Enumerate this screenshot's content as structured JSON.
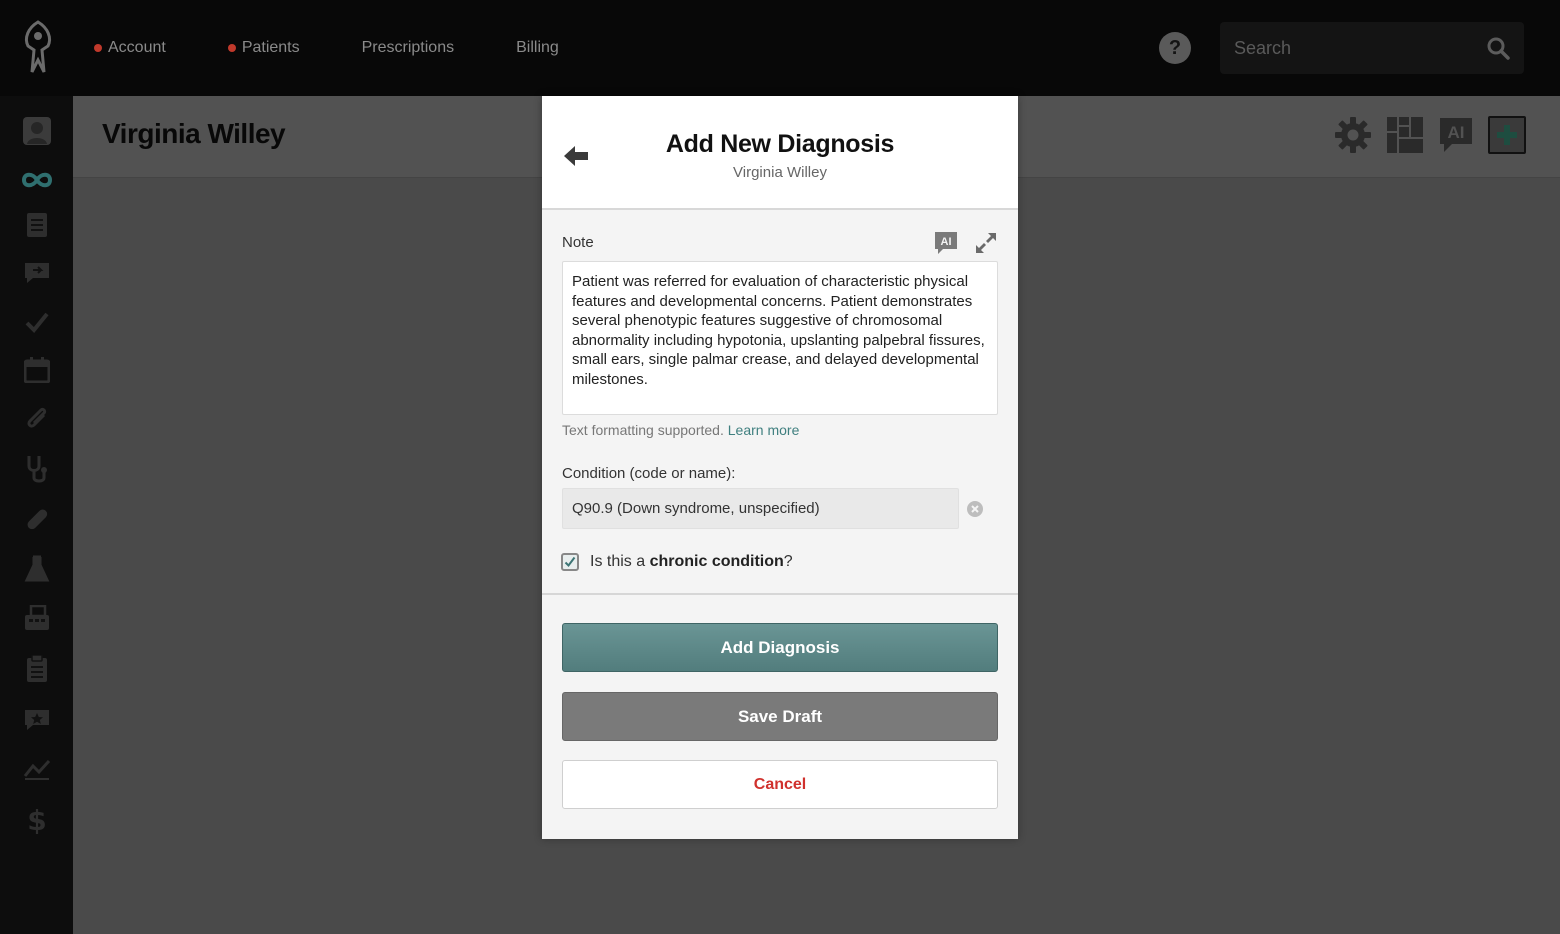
{
  "nav": {
    "items": [
      {
        "label": "Account",
        "alert": true
      },
      {
        "label": "Patients",
        "alert": true
      },
      {
        "label": "Prescriptions",
        "alert": false
      },
      {
        "label": "Billing",
        "alert": false
      }
    ],
    "help_label": "?",
    "search_placeholder": "Search"
  },
  "sidebar": {
    "icons": [
      "profile-icon",
      "timeline-icon",
      "documents-icon",
      "messages-icon",
      "tasks-icon",
      "calendar-icon",
      "attachments-icon",
      "stethoscope-icon",
      "medications-icon",
      "labs-icon",
      "fax-icon",
      "clipboard-icon",
      "reviews-icon",
      "trends-icon",
      "billing-icon"
    ],
    "active": "timeline-icon"
  },
  "header": {
    "patient_name": "Virginia Willey",
    "actions": [
      "settings-icon",
      "dashboard-icon",
      "ai-assistant-icon",
      "add-icon"
    ]
  },
  "modal": {
    "title": "Add New Diagnosis",
    "subtitle": "Virginia Willey",
    "note_label": "Note",
    "note_value": "Patient was referred for evaluation of characteristic physical features and developmental concerns. Patient demonstrates several phenotypic features suggestive of chromosomal abnormality including hypotonia, upslanting palpebral fissures, small ears, single palmar crease, and delayed developmental milestones.",
    "format_hint": "Text formatting supported.",
    "learn_more": "Learn more",
    "condition_label": "Condition (code or name):",
    "condition_value": "Q90.9 (Down syndrome, unspecified)",
    "chronic_prefix": "Is this a ",
    "chronic_bold": "chronic condition",
    "chronic_suffix": "?",
    "chronic_checked": true,
    "add_button": "Add Diagnosis",
    "draft_button": "Save Draft",
    "cancel_button": "Cancel"
  },
  "colors": {
    "accent": "#5a8787",
    "alert_dot": "#c0392b",
    "cancel_text": "#d0312d",
    "topbar": "#080808"
  }
}
